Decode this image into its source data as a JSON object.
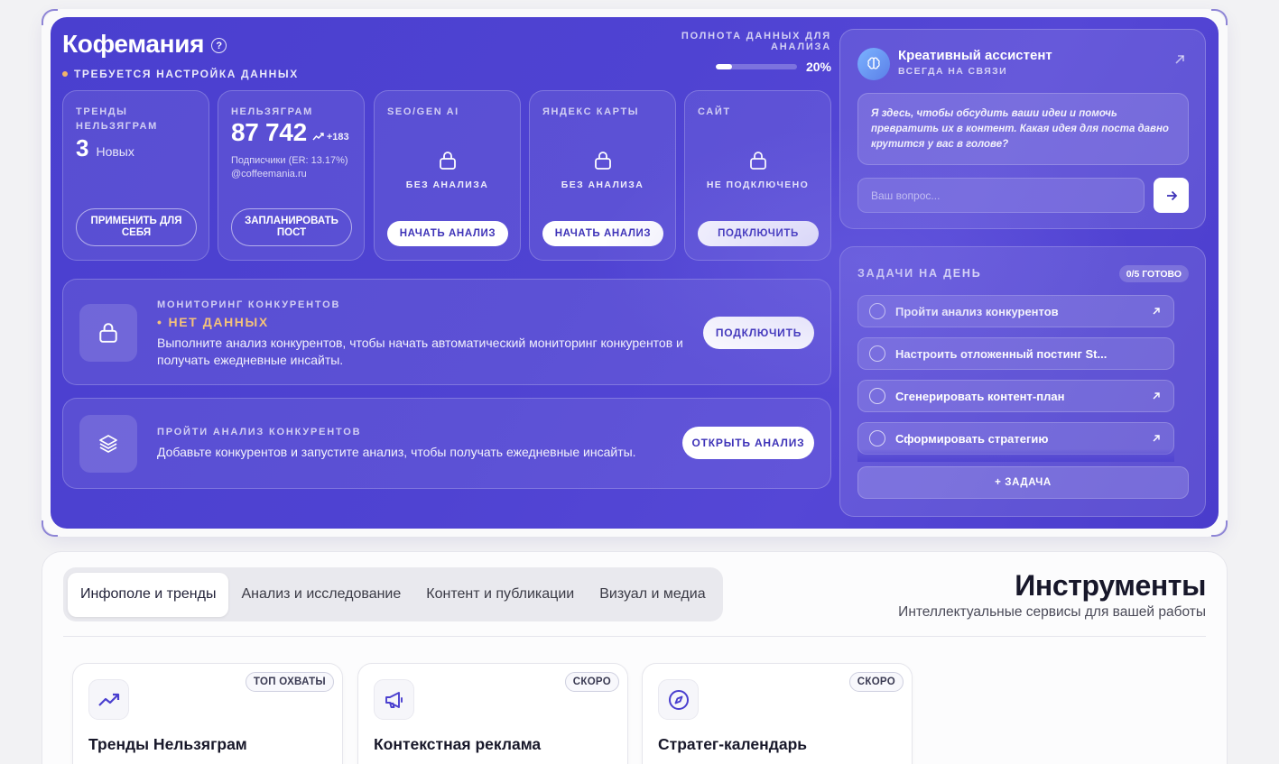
{
  "header": {
    "brand": "Кофемания",
    "setup_status": "ТРЕБУЕТСЯ НАСТРОЙКА ДАННЫХ",
    "completeness_label": "ПОЛНОТА ДАННЫХ ДЛЯ АНАЛИЗА",
    "completeness_value": "20%",
    "completeness_fraction": 0.2
  },
  "cards": {
    "trends": {
      "title": "ТРЕНДЫ НЕЛЬЗЯГРАМ",
      "count": "3",
      "count_label": "Новых",
      "button": "ПРИМЕНИТЬ ДЛЯ СЕБЯ"
    },
    "nelzyagram": {
      "title": "НЕЛЬЗЯГРАМ",
      "subscribers": "87 742",
      "delta": "+183",
      "meta": "Подписчики (ER: 13.17%)",
      "handle": "@coffeemania.ru",
      "button": "ЗАПЛАНИРОВАТЬ ПОСТ"
    },
    "seo": {
      "title": "SEO/GEN AI",
      "status": "БЕЗ АНАЛИЗА",
      "button": "НАЧАТЬ АНАЛИЗ"
    },
    "yandex": {
      "title": "ЯНДЕКС КАРТЫ",
      "status": "БЕЗ АНАЛИЗА",
      "button": "НАЧАТЬ АНАЛИЗ"
    },
    "site": {
      "title": "САЙТ",
      "status": "НЕ ПОДКЛЮЧЕНО",
      "button": "ПОДКЛЮЧИТЬ"
    }
  },
  "monitoring": {
    "title": "МОНИТОРИНГ КОНКУРЕНТОВ",
    "status": "НЕТ ДАННЫХ",
    "text": "Выполните анализ конкурентов, чтобы начать автоматический мониторинг конкурентов и получать ежедневные инсайты.",
    "button": "ПОДКЛЮЧИТЬ"
  },
  "analysis": {
    "title": "ПРОЙТИ АНАЛИЗ КОНКУРЕНТОВ",
    "text": "Добавьте конкурентов и запустите анализ, чтобы получать ежедневные инсайты.",
    "button": "ОТКРЫТЬ АНАЛИЗ"
  },
  "assistant": {
    "name": "Креативный ассистент",
    "subtitle": "ВСЕГДА НА СВЯЗИ",
    "message": "Я здесь, чтобы обсудить ваши идеи и помочь превратить их в контент. Какая идея для поста давно крутится у вас в голове?",
    "input_placeholder": "Ваш вопрос..."
  },
  "tasks": {
    "title": "ЗАДАЧИ НА ДЕНЬ",
    "badge": "0/5 ГОТОВО",
    "items": [
      {
        "label": "Пройти анализ конкурентов"
      },
      {
        "label": "Настроить отложенный постинг St..."
      },
      {
        "label": "Сгенерировать контент-план"
      },
      {
        "label": "Сформировать стратегию"
      }
    ],
    "add_button": "+ ЗАДАЧА"
  },
  "tools": {
    "tabs": [
      "Инфополе и тренды",
      "Анализ и исследование",
      "Контент и публикации",
      "Визуал и медиа"
    ],
    "active_tab": 0,
    "title": "Инструменты",
    "subtitle": "Интеллектуальные сервисы для вашей работы",
    "cards": [
      {
        "name": "Тренды Нельзяграм",
        "badge": "ТОП ОХВАТЫ",
        "icon": "trending-up-icon"
      },
      {
        "name": "Контекстная реклама",
        "badge": "СКОРО",
        "icon": "megaphone-icon"
      },
      {
        "name": "Стратег-календарь",
        "badge": "СКОРО",
        "icon": "compass-icon"
      }
    ]
  },
  "colors": {
    "hero_bg": "#4f43d2",
    "accent_text": "#3e33b8",
    "status_warn": "#f4c27a",
    "dot_orange": "#f2b46a"
  }
}
